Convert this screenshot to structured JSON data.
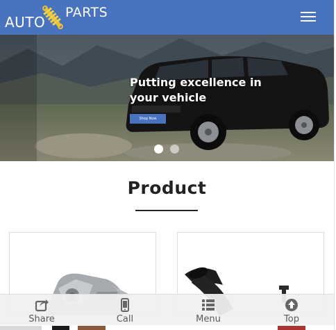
{
  "header": {
    "logo_auto": "AUTO",
    "logo_parts": "PARTS",
    "colors": {
      "header_bg": "#4a73bf"
    }
  },
  "hero": {
    "heading": "Putting excellence in your vehicle",
    "button_label": "Shop Now",
    "slides_count": 2,
    "active_slide": 1
  },
  "products": {
    "title": "Product"
  },
  "bottom_nav": {
    "items": [
      {
        "label": "Share",
        "icon": "share-icon"
      },
      {
        "label": "Call",
        "icon": "phone-icon"
      },
      {
        "label": "Menu",
        "icon": "list-icon"
      },
      {
        "label": "Top",
        "icon": "arrow-up-circle-icon"
      }
    ]
  }
}
